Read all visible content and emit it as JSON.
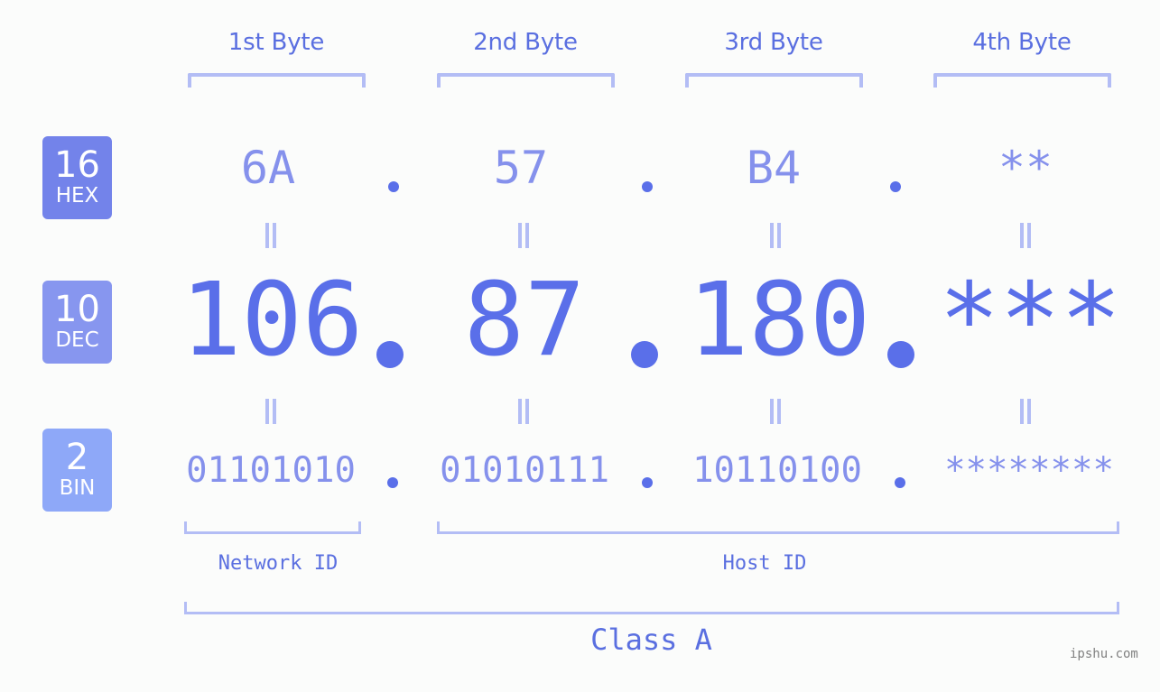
{
  "byte_headers": [
    "1st Byte",
    "2nd Byte",
    "3rd Byte",
    "4th Byte"
  ],
  "badges": {
    "hex": {
      "number": "16",
      "label": "HEX",
      "color": "#7383ea"
    },
    "dec": {
      "number": "10",
      "label": "DEC",
      "color": "#8796ef"
    },
    "bin": {
      "number": "2",
      "label": "BIN",
      "color": "#8ea8f8"
    }
  },
  "hex": [
    "6A",
    "57",
    "B4",
    "**"
  ],
  "dec": [
    "106",
    "87",
    "180",
    "***"
  ],
  "bin": [
    "01101010",
    "01010111",
    "10110100",
    "********"
  ],
  "labels": {
    "network_id": "Network ID",
    "host_id": "Host ID",
    "ip_class": "Class A"
  },
  "watermark": "ipshu.com",
  "colors": {
    "primary": "#5a6fe9",
    "secondary": "#8591ec",
    "bracket": "#b3bdf5",
    "background": "#fbfcfb"
  }
}
